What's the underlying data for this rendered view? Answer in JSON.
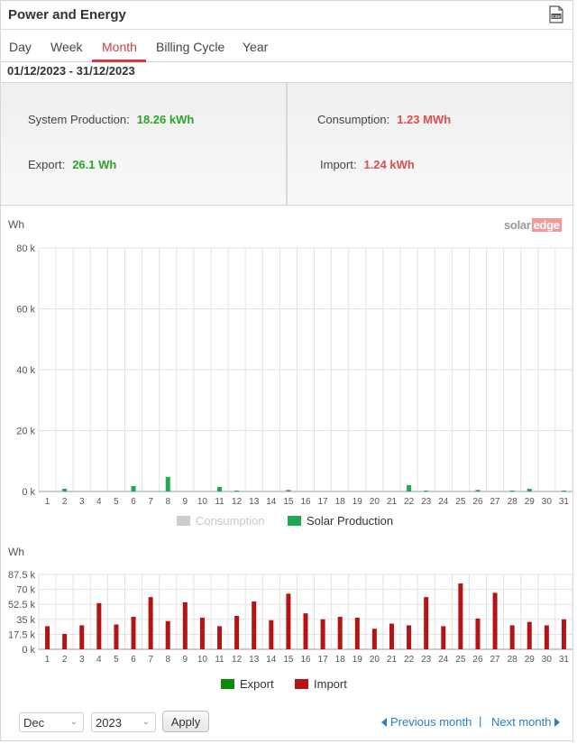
{
  "header": {
    "title": "Power and Energy",
    "csv_icon": "csv-file-icon"
  },
  "tabs": [
    {
      "label": "Day",
      "active": false
    },
    {
      "label": "Week",
      "active": false
    },
    {
      "label": "Month",
      "active": true
    },
    {
      "label": "Billing Cycle",
      "active": false
    },
    {
      "label": "Year",
      "active": false
    }
  ],
  "date_range": "01/12/2023 - 31/12/2023",
  "summary": {
    "production": {
      "label": "System Production:",
      "value": "18.26 kWh"
    },
    "export": {
      "label": "Export:",
      "value": "26.1 Wh"
    },
    "consumption": {
      "label": "Consumption:",
      "value": "1.23 MWh"
    },
    "import": {
      "label": "Import:",
      "value": "1.24 kWh"
    }
  },
  "brand": {
    "part1": "solar",
    "part2": "edge"
  },
  "colors": {
    "accent": "#d93b3b",
    "production": "#1faa52",
    "consumption": "#cccccc",
    "export": "#0c8a0c",
    "import": "#b51414",
    "link": "#2b7fc2"
  },
  "chart_data": [
    {
      "type": "bar",
      "ylabel": "Wh",
      "ylim": [
        0,
        80000
      ],
      "yticks": [
        "0 k",
        "20 k",
        "40 k",
        "60 k",
        "80 k"
      ],
      "categories": [
        "1",
        "2",
        "3",
        "4",
        "5",
        "6",
        "7",
        "8",
        "9",
        "10",
        "11",
        "12",
        "13",
        "14",
        "15",
        "16",
        "17",
        "18",
        "19",
        "20",
        "21",
        "22",
        "23",
        "24",
        "25",
        "26",
        "27",
        "28",
        "29",
        "30",
        "31"
      ],
      "series": [
        {
          "name": "Consumption",
          "hidden": true,
          "values": []
        },
        {
          "name": "Solar Production",
          "values": [
            0,
            900,
            0,
            0,
            0,
            1800,
            0,
            4800,
            0,
            0,
            1500,
            300,
            0,
            0,
            500,
            0,
            0,
            0,
            0,
            0,
            0,
            2100,
            300,
            0,
            0,
            500,
            0,
            300,
            900,
            0,
            300
          ]
        }
      ],
      "grid": true,
      "legend": "bottom"
    },
    {
      "type": "bar",
      "ylabel": "Wh",
      "ylim": [
        0,
        87500
      ],
      "yticks": [
        "0 k",
        "17.5 k",
        "35 k",
        "52.5 k",
        "70 k",
        "87.5 k"
      ],
      "categories": [
        "1",
        "2",
        "3",
        "4",
        "5",
        "6",
        "7",
        "8",
        "9",
        "10",
        "11",
        "12",
        "13",
        "14",
        "15",
        "16",
        "17",
        "18",
        "19",
        "20",
        "21",
        "22",
        "23",
        "24",
        "25",
        "26",
        "27",
        "28",
        "29",
        "30",
        "31"
      ],
      "series": [
        {
          "name": "Export",
          "values": [
            0,
            0,
            0,
            0,
            0,
            0,
            0,
            0,
            0,
            0,
            0,
            0,
            0,
            0,
            0,
            0,
            0,
            0,
            0,
            0,
            0,
            0,
            0,
            0,
            0,
            0,
            0,
            0,
            0,
            0,
            0
          ]
        },
        {
          "name": "Import",
          "values": [
            27000,
            18000,
            28000,
            54000,
            29000,
            38000,
            61000,
            33000,
            55000,
            37000,
            27000,
            39000,
            56000,
            34000,
            65000,
            42000,
            35000,
            38000,
            37000,
            24000,
            30000,
            28000,
            61000,
            27000,
            77000,
            36000,
            66000,
            28000,
            32000,
            28000,
            35000
          ]
        }
      ],
      "grid": true,
      "legend": "bottom"
    }
  ],
  "controls": {
    "month": "Dec",
    "year": "2023",
    "apply_label": "Apply",
    "prev_label": "Previous month",
    "separator": "|",
    "next_label": "Next month"
  }
}
